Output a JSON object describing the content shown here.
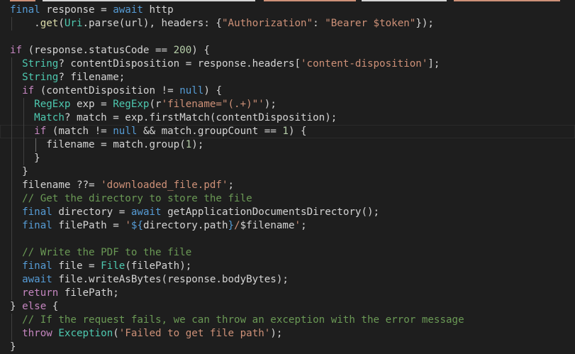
{
  "editor": {
    "language": "dart",
    "top_strip_colors": [
      "#ce9178",
      "#d4d4d4",
      "#ce9178",
      "#d4d4d4",
      "#ce9178"
    ],
    "lines": [
      {
        "indent": 0,
        "guides": [],
        "tokens": [
          {
            "t": "final",
            "c": "kw"
          },
          {
            "t": " response = ",
            "c": "pl"
          },
          {
            "t": "await",
            "c": "kw"
          },
          {
            "t": " http",
            "c": "pl"
          }
        ]
      },
      {
        "indent": 1,
        "guides": [
          0
        ],
        "tokens": [
          {
            "t": "    .",
            "c": "pl"
          },
          {
            "t": "get",
            "c": "fn"
          },
          {
            "t": "(",
            "c": "pl"
          },
          {
            "t": "Uri",
            "c": "ty"
          },
          {
            "t": ".parse(url), headers: {",
            "c": "pl"
          },
          {
            "t": "\"Authorization\"",
            "c": "str"
          },
          {
            "t": ": ",
            "c": "pl"
          },
          {
            "t": "\"Bearer $token\"",
            "c": "str"
          },
          {
            "t": "});",
            "c": "pl"
          }
        ]
      },
      {
        "indent": 0,
        "guides": [],
        "tokens": []
      },
      {
        "indent": 0,
        "guides": [],
        "tokens": [
          {
            "t": "if",
            "c": "ctl"
          },
          {
            "t": " (response.statusCode == ",
            "c": "pl"
          },
          {
            "t": "200",
            "c": "num"
          },
          {
            "t": ") {",
            "c": "pl"
          }
        ]
      },
      {
        "indent": 1,
        "guides": [
          0
        ],
        "tokens": [
          {
            "t": "  ",
            "c": "pl"
          },
          {
            "t": "String",
            "c": "ty"
          },
          {
            "t": "? contentDisposition = response.headers[",
            "c": "pl"
          },
          {
            "t": "'content-disposition'",
            "c": "str"
          },
          {
            "t": "];",
            "c": "pl"
          }
        ]
      },
      {
        "indent": 1,
        "guides": [
          0
        ],
        "tokens": [
          {
            "t": "  ",
            "c": "pl"
          },
          {
            "t": "String",
            "c": "ty"
          },
          {
            "t": "? filename;",
            "c": "pl"
          }
        ]
      },
      {
        "indent": 1,
        "guides": [
          0
        ],
        "tokens": [
          {
            "t": "  ",
            "c": "pl"
          },
          {
            "t": "if",
            "c": "ctl"
          },
          {
            "t": " (contentDisposition != ",
            "c": "pl"
          },
          {
            "t": "null",
            "c": "kw"
          },
          {
            "t": ") {",
            "c": "pl"
          }
        ]
      },
      {
        "indent": 2,
        "guides": [
          0,
          1
        ],
        "tokens": [
          {
            "t": "    ",
            "c": "pl"
          },
          {
            "t": "RegExp",
            "c": "ty"
          },
          {
            "t": " exp = ",
            "c": "pl"
          },
          {
            "t": "RegExp",
            "c": "ty"
          },
          {
            "t": "(r",
            "c": "pl"
          },
          {
            "t": "'filename=\"(.+)\"'",
            "c": "str"
          },
          {
            "t": ");",
            "c": "pl"
          }
        ]
      },
      {
        "indent": 2,
        "guides": [
          0,
          1
        ],
        "tokens": [
          {
            "t": "    ",
            "c": "pl"
          },
          {
            "t": "Match",
            "c": "ty"
          },
          {
            "t": "? match = exp.",
            "c": "pl"
          },
          {
            "t": "firstMatch",
            "c": "pl"
          },
          {
            "t": "(contentDisposition);",
            "c": "pl"
          }
        ]
      },
      {
        "indent": 2,
        "guides": [
          0,
          1
        ],
        "current": true,
        "tokens": [
          {
            "t": "    ",
            "c": "pl"
          },
          {
            "t": "if",
            "c": "ctl"
          },
          {
            "t": " (match != ",
            "c": "pl"
          },
          {
            "t": "null",
            "c": "kw"
          },
          {
            "t": " && match.groupCount == ",
            "c": "pl"
          },
          {
            "t": "1",
            "c": "num"
          },
          {
            "t": ") {",
            "c": "pl"
          }
        ]
      },
      {
        "indent": 3,
        "guides": [
          0,
          1,
          2
        ],
        "active_guide": 2,
        "tokens": [
          {
            "t": "      filename = match.",
            "c": "pl"
          },
          {
            "t": "group",
            "c": "pl"
          },
          {
            "t": "(",
            "c": "pl"
          },
          {
            "t": "1",
            "c": "num"
          },
          {
            "t": ");",
            "c": "pl"
          }
        ]
      },
      {
        "indent": 2,
        "guides": [
          0,
          1
        ],
        "tokens": [
          {
            "t": "    }",
            "c": "pl"
          }
        ]
      },
      {
        "indent": 1,
        "guides": [
          0
        ],
        "tokens": [
          {
            "t": "  }",
            "c": "pl"
          }
        ]
      },
      {
        "indent": 1,
        "guides": [
          0
        ],
        "tokens": [
          {
            "t": "  filename ??= ",
            "c": "pl"
          },
          {
            "t": "'downloaded_file.pdf'",
            "c": "str"
          },
          {
            "t": ";",
            "c": "pl"
          }
        ]
      },
      {
        "indent": 1,
        "guides": [
          0
        ],
        "tokens": [
          {
            "t": "  ",
            "c": "pl"
          },
          {
            "t": "// Get the directory to store the file",
            "c": "cm"
          }
        ]
      },
      {
        "indent": 1,
        "guides": [
          0
        ],
        "tokens": [
          {
            "t": "  ",
            "c": "pl"
          },
          {
            "t": "final",
            "c": "kw"
          },
          {
            "t": " directory = ",
            "c": "pl"
          },
          {
            "t": "await",
            "c": "kw"
          },
          {
            "t": " ",
            "c": "pl"
          },
          {
            "t": "getApplicationDocumentsDirectory",
            "c": "pl"
          },
          {
            "t": "();",
            "c": "pl"
          }
        ]
      },
      {
        "indent": 1,
        "guides": [
          0
        ],
        "tokens": [
          {
            "t": "  ",
            "c": "pl"
          },
          {
            "t": "final",
            "c": "kw"
          },
          {
            "t": " filePath = ",
            "c": "pl"
          },
          {
            "t": "'",
            "c": "str"
          },
          {
            "t": "${",
            "c": "interp"
          },
          {
            "t": "directory.path",
            "c": "pl"
          },
          {
            "t": "}",
            "c": "interp"
          },
          {
            "t": "/",
            "c": "str"
          },
          {
            "t": "$filename",
            "c": "pl"
          },
          {
            "t": "'",
            "c": "str"
          },
          {
            "t": ";",
            "c": "pl"
          }
        ]
      },
      {
        "indent": 0,
        "guides": [
          0
        ],
        "tokens": []
      },
      {
        "indent": 1,
        "guides": [
          0
        ],
        "tokens": [
          {
            "t": "  ",
            "c": "pl"
          },
          {
            "t": "// Write the PDF to the file",
            "c": "cm"
          }
        ]
      },
      {
        "indent": 1,
        "guides": [
          0
        ],
        "tokens": [
          {
            "t": "  ",
            "c": "pl"
          },
          {
            "t": "final",
            "c": "kw"
          },
          {
            "t": " file = ",
            "c": "pl"
          },
          {
            "t": "File",
            "c": "ty"
          },
          {
            "t": "(filePath);",
            "c": "pl"
          }
        ]
      },
      {
        "indent": 1,
        "guides": [
          0
        ],
        "tokens": [
          {
            "t": "  ",
            "c": "pl"
          },
          {
            "t": "await",
            "c": "kw"
          },
          {
            "t": " file.writeAsBytes(response.bodyBytes);",
            "c": "pl"
          }
        ]
      },
      {
        "indent": 1,
        "guides": [
          0
        ],
        "tokens": [
          {
            "t": "  ",
            "c": "pl"
          },
          {
            "t": "return",
            "c": "ctl"
          },
          {
            "t": " filePath;",
            "c": "pl"
          }
        ]
      },
      {
        "indent": 0,
        "guides": [],
        "tokens": [
          {
            "t": "} ",
            "c": "pl"
          },
          {
            "t": "else",
            "c": "ctl"
          },
          {
            "t": " {",
            "c": "pl"
          }
        ]
      },
      {
        "indent": 1,
        "guides": [
          0
        ],
        "tokens": [
          {
            "t": "  ",
            "c": "pl"
          },
          {
            "t": "// If the request fails, we can throw an exception with the error message",
            "c": "cm"
          }
        ]
      },
      {
        "indent": 1,
        "guides": [
          0
        ],
        "tokens": [
          {
            "t": "  ",
            "c": "pl"
          },
          {
            "t": "throw",
            "c": "ctl"
          },
          {
            "t": " ",
            "c": "pl"
          },
          {
            "t": "Exception",
            "c": "ty"
          },
          {
            "t": "(",
            "c": "pl"
          },
          {
            "t": "'Failed to get file path'",
            "c": "str"
          },
          {
            "t": ");",
            "c": "pl"
          }
        ]
      },
      {
        "indent": 0,
        "guides": [],
        "tokens": [
          {
            "t": "}",
            "c": "pl"
          }
        ]
      }
    ]
  }
}
